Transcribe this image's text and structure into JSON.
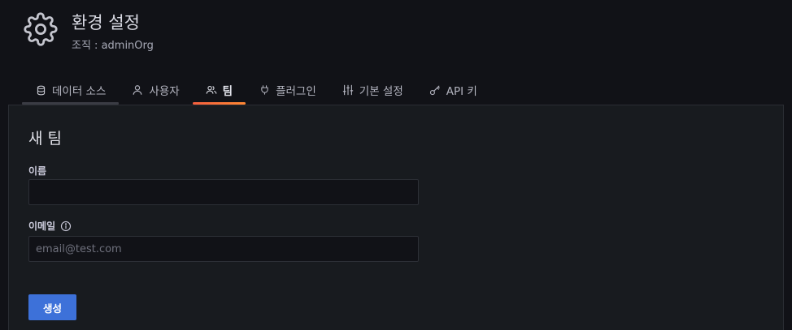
{
  "header": {
    "title": "환경 설정",
    "subtitle": "조직 : adminOrg",
    "icon": "gear-icon"
  },
  "tabs": [
    {
      "label": "데이터 소스",
      "icon": "database-icon",
      "active": false
    },
    {
      "label": "사용자",
      "icon": "user-icon",
      "active": false
    },
    {
      "label": "팀",
      "icon": "users-icon",
      "active": true
    },
    {
      "label": "플러그인",
      "icon": "plug-icon",
      "active": false
    },
    {
      "label": "기본 설정",
      "icon": "sliders-icon",
      "active": false
    },
    {
      "label": "API 키",
      "icon": "key-icon",
      "active": false
    }
  ],
  "form": {
    "title": "새 팀",
    "name_label": "이름",
    "name_value": "",
    "email_label": "이메일",
    "email_value": "",
    "email_placeholder": "email@test.com",
    "submit_label": "생성"
  },
  "colors": {
    "background": "#111217",
    "panel": "#181b1f",
    "accent": "#3d71d9",
    "active_tab_underline": "#f55f3e"
  }
}
